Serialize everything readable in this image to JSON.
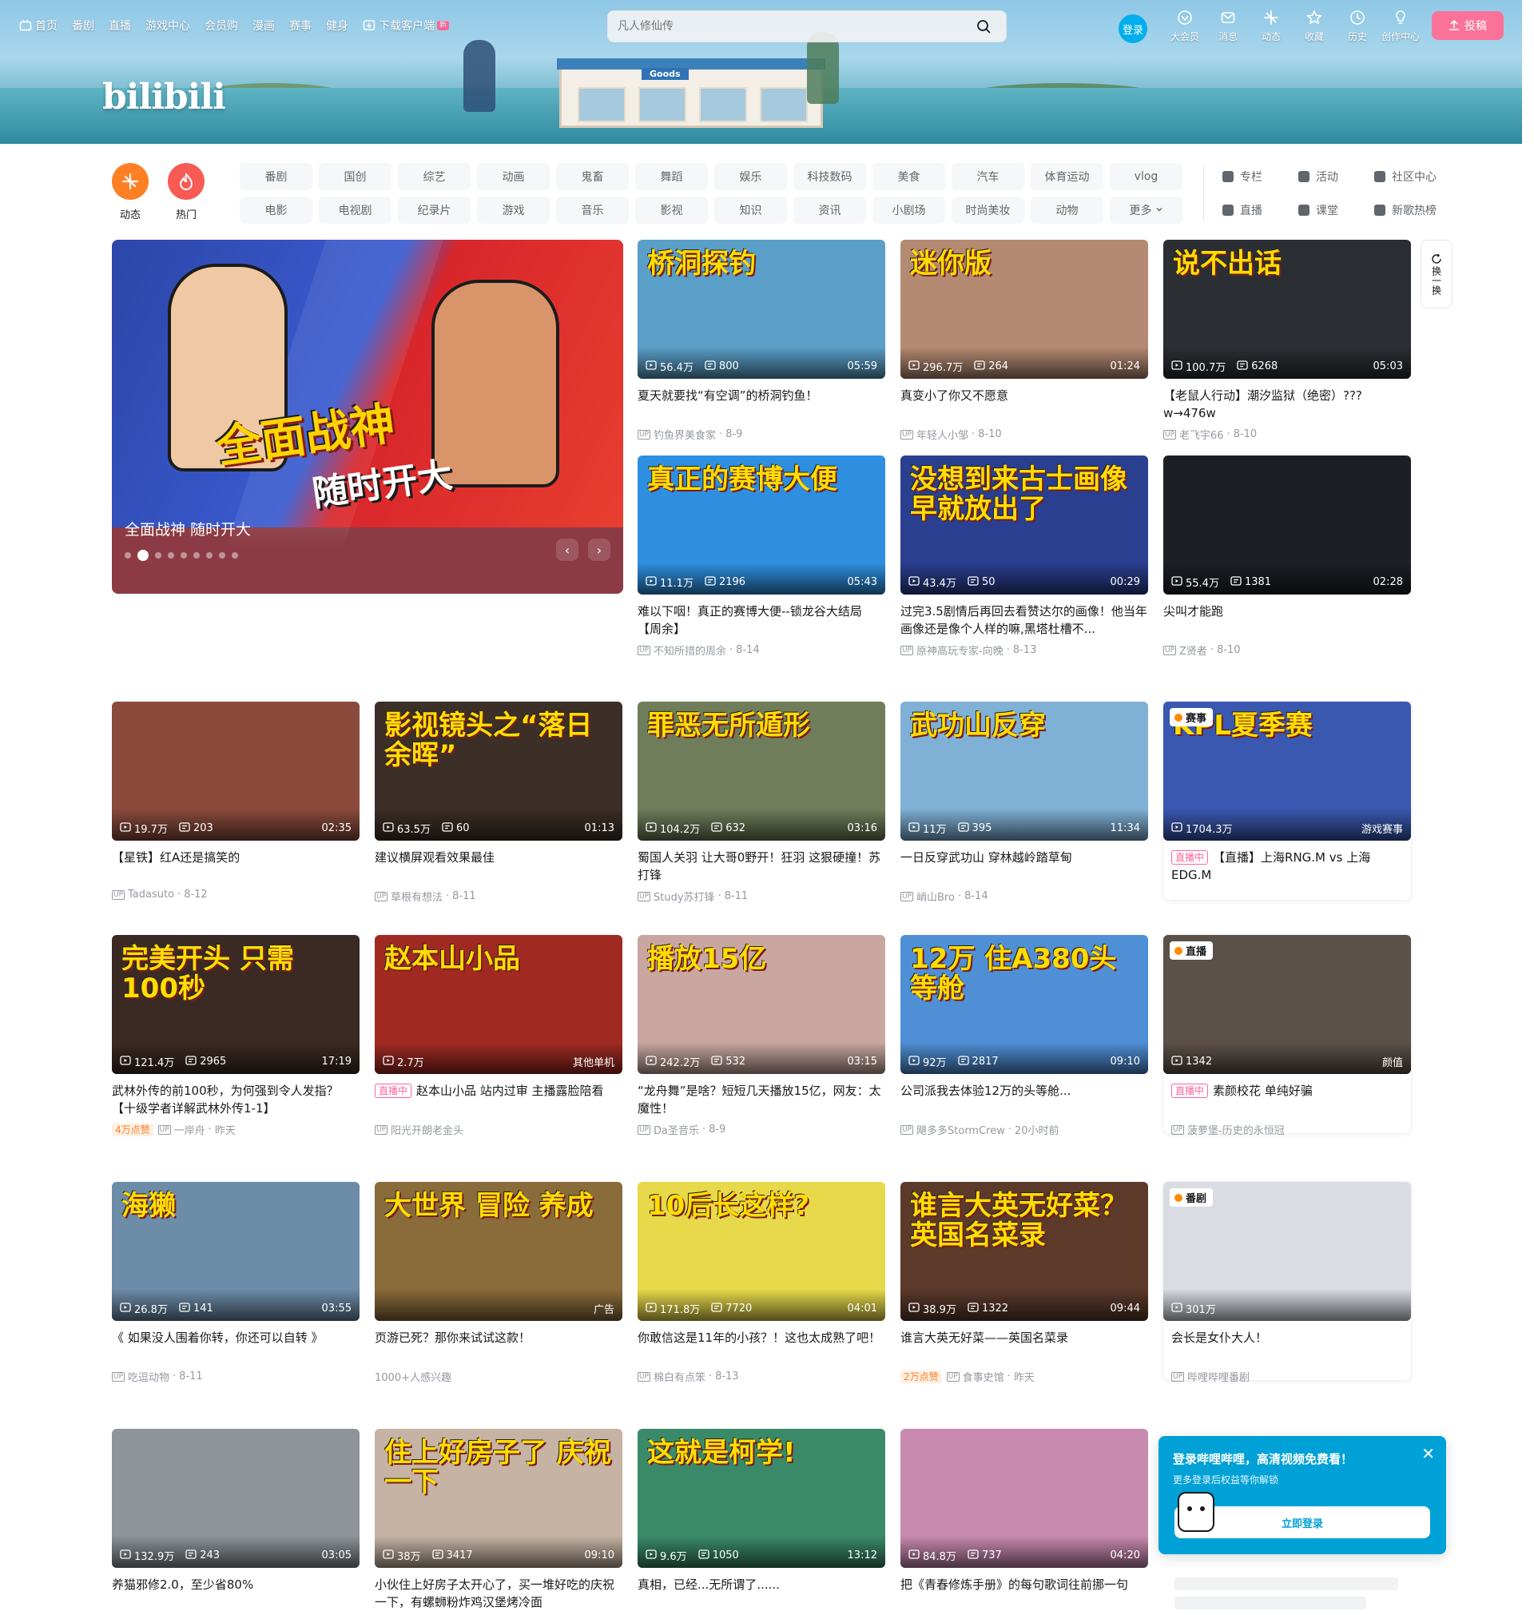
{
  "header": {
    "nav": [
      {
        "label": "首页",
        "icon": "tv-icon"
      },
      {
        "label": "番剧"
      },
      {
        "label": "直播"
      },
      {
        "label": "游戏中心"
      },
      {
        "label": "会员购"
      },
      {
        "label": "漫画"
      },
      {
        "label": "赛事"
      },
      {
        "label": "健身"
      },
      {
        "label": "下载客户端",
        "icon": "download-icon",
        "badge": "新"
      }
    ],
    "search_placeholder": "凡人修仙传",
    "login_label": "登录",
    "right_nav": [
      {
        "label": "大会员",
        "icon": "vip-icon"
      },
      {
        "label": "消息",
        "icon": "message-icon"
      },
      {
        "label": "动态",
        "icon": "dynamic-icon"
      },
      {
        "label": "收藏",
        "icon": "favorite-icon"
      },
      {
        "label": "历史",
        "icon": "history-icon"
      },
      {
        "label": "创作中心",
        "icon": "creator-icon"
      }
    ],
    "upload_label": "投稿",
    "logo_text": "bilibili"
  },
  "channels": {
    "big": [
      {
        "label": "动态",
        "color": "#ff7f24",
        "icon": "dynamic-icon"
      },
      {
        "label": "热门",
        "color": "#f85a54",
        "icon": "fire-icon"
      }
    ],
    "grid": [
      "番剧",
      "国创",
      "综艺",
      "动画",
      "鬼畜",
      "舞蹈",
      "娱乐",
      "科技数码",
      "美食",
      "汽车",
      "体育运动",
      "vlog",
      "电影",
      "电视剧",
      "纪录片",
      "游戏",
      "音乐",
      "影视",
      "知识",
      "资讯",
      "小剧场",
      "时尚美妆",
      "动物",
      "更多"
    ],
    "extra": [
      "专栏",
      "活动",
      "社区中心",
      "直播",
      "课堂",
      "新歌热榜"
    ]
  },
  "carousel": {
    "title": "全面战神 随时开大",
    "art_caption": "全面战神",
    "art_caption2": "随时开大"
  },
  "refresh_label": "换一换",
  "feed_top": [
    {
      "title": "夏天就要找“有空调”的桥洞钓鱼！",
      "views": "56.4万",
      "danmaku": "800",
      "duration": "05:59",
      "author": "钓鱼界美食家",
      "date": "8-9",
      "bg": "#5a9fc8",
      "overlay": "桥洞探钓"
    },
    {
      "title": "真变小了你又不愿意",
      "views": "296.7万",
      "danmaku": "264",
      "duration": "01:24",
      "author": "年轻人小邹",
      "date": "8-10",
      "bg": "#b58a72",
      "overlay": "迷你版"
    },
    {
      "title": "【老鼠人行动】潮汐监狱（绝密）???w→476w",
      "views": "100.7万",
      "danmaku": "6268",
      "duration": "05:03",
      "author": "老飞宇66",
      "date": "8-10",
      "bg": "#2b2e33",
      "overlay": "说不出话"
    },
    {
      "title": "难以下咽！真正的赛博大便--锁龙谷大结局【周余】",
      "views": "11.1万",
      "danmaku": "2196",
      "duration": "05:43",
      "author": "不知所措的周余",
      "date": "8-14",
      "bg": "#2e8fe0",
      "overlay": "真正的赛博大便"
    },
    {
      "title": "过完3.5剧情后再回去看赞达尔的画像！他当年画像还是像个人样的嘛,黑塔杜槽不...",
      "views": "43.4万",
      "danmaku": "50",
      "duration": "00:29",
      "author": "原神高玩专家-向晚",
      "date": "8-13",
      "bg": "#2a3f8f",
      "overlay": "没想到来古士画像早就放出了"
    },
    {
      "title": "尖叫才能跑",
      "views": "55.4万",
      "danmaku": "1381",
      "duration": "02:28",
      "author": "Z贤者",
      "date": "8-10",
      "bg": "#1c1f24",
      "overlay": ""
    }
  ],
  "feed": [
    {
      "title": "【星铁】红A还是搞笑的",
      "views": "19.7万",
      "danmaku": "203",
      "duration": "02:35",
      "author": "Tadasuto",
      "date": "8-12",
      "bg": "#8a4b3c",
      "overlay": ""
    },
    {
      "title": "建议横屏观看效果最佳",
      "views": "63.5万",
      "danmaku": "60",
      "duration": "01:13",
      "author": "草根有想法",
      "date": "8-11",
      "bg": "#3b2f27",
      "overlay": "影视镜头之“落日余晖”"
    },
    {
      "title": "蜀国人关羽 让大哥0野开！狂羽 这狠硬撞！苏打锋",
      "views": "104.2万",
      "danmaku": "632",
      "duration": "03:16",
      "author": "Study苏打锋",
      "date": "8-11",
      "bg": "#6f7d5a",
      "overlay": "罪恶无所遁形"
    },
    {
      "title": "一日反穿武功山 穿林越岭踏草甸",
      "views": "11万",
      "danmaku": "395",
      "duration": "11:34",
      "author": "峭山Bro",
      "date": "8-14",
      "bg": "#7fb0d6",
      "overlay": "武功山反穿"
    },
    {
      "title": "【直播】上海RNG.M vs 上海EDG.M",
      "views": "1704.3万",
      "danmaku": "",
      "duration": "游戏赛事",
      "author": "",
      "date": "",
      "bg": "#3a58b0",
      "overlay": "KPL夏季赛",
      "tag": "赛事",
      "live": "直播中",
      "boxed": true
    },
    {
      "title": "武林外传的前100秒，为何强到令人发指？【十级学者详解武林外传1-1】",
      "views": "121.4万",
      "danmaku": "2965",
      "duration": "17:19",
      "author": "一岸舟",
      "date": "昨天",
      "bg": "#3b2a24",
      "overlay": "完美开头 只需100秒",
      "likes": "4万点赞"
    },
    {
      "title": "赵本山小品 站内过审 主播露脸陪看",
      "views": "2.7万",
      "danmaku": "",
      "duration": "其他单机",
      "author": "阳光开朗老金头",
      "date": "",
      "bg": "#a02a22",
      "overlay": "赵本山小品",
      "live": "直播中"
    },
    {
      "title": "“龙舟舞”是啥？短短几天播放15亿，网友：太魔性！",
      "views": "242.2万",
      "danmaku": "532",
      "duration": "03:15",
      "author": "Da圣音乐",
      "date": "8-9",
      "bg": "#c9a7a0",
      "overlay": "播放15亿"
    },
    {
      "title": "公司派我去体验12万的头等舱...",
      "views": "92万",
      "danmaku": "2817",
      "duration": "09:10",
      "author": "飓多多StormCrew",
      "date": "20小时前",
      "bg": "#4f8fd6",
      "overlay": "12万 住A380头等舱"
    },
    {
      "title": "素颜校花 单纯好骗",
      "views": "1342",
      "danmaku": "",
      "duration": "颜值",
      "author": "菠萝堡-历史的永恒冠",
      "date": "",
      "bg": "#5c5149",
      "overlay": "",
      "tag": "直播",
      "live": "直播中",
      "boxed": true
    },
    {
      "title": "《 如果没人围着你转，你还可以自转 》",
      "views": "26.8万",
      "danmaku": "141",
      "duration": "03:55",
      "author": "吃逗动物",
      "date": "8-11",
      "bg": "#6d8ca8",
      "overlay": "海獭"
    },
    {
      "title": "页游已死？那你来试试这款！",
      "views": "",
      "danmaku": "",
      "duration": "广告",
      "author": "1000+人感兴趣",
      "date": "",
      "bg": "#8a6b3a",
      "overlay": "大世界 冒险 养成"
    },
    {
      "title": "你敢信这是11年的小孩？！这也太成熟了吧！",
      "views": "171.8万",
      "danmaku": "7720",
      "duration": "04:01",
      "author": "棉白有点笨",
      "date": "8-13",
      "bg": "#e8d94a",
      "overlay": "10后长这样?"
    },
    {
      "title": "谁言大英无好菜——英国名菜录",
      "views": "38.9万",
      "danmaku": "1322",
      "duration": "09:44",
      "author": "食事史馆",
      "date": "昨天",
      "bg": "#5b3a2a",
      "overlay": "谁言大英无好菜？英国名菜录",
      "likes": "2万点赞"
    },
    {
      "title": "会长是女仆大人！",
      "views": "301万",
      "danmaku": "",
      "duration": "",
      "author": "哔哩哔哩番剧",
      "date": "",
      "bg": "#d9dde3",
      "overlay": "",
      "tag": "番剧",
      "boxed": true
    },
    {
      "title": "养猫邪修2.0，至少省80%",
      "views": "132.9万",
      "danmaku": "243",
      "duration": "03:05",
      "author": "",
      "date": "",
      "bg": "#8e9499",
      "overlay": ""
    },
    {
      "title": "小伙住上好房子太开心了，买一堆好吃的庆祝一下，有螺蛳粉炸鸡汉堡烤冷面",
      "views": "38万",
      "danmaku": "3417",
      "duration": "09:10",
      "author": "",
      "date": "",
      "bg": "#c7b3a3",
      "overlay": "住上好房子了 庆祝一下"
    },
    {
      "title": "真相，已经...无所谓了......",
      "views": "9.6万",
      "danmaku": "1050",
      "duration": "13:12",
      "author": "",
      "date": "",
      "bg": "#3a8a6a",
      "overlay": "这就是柯学!"
    },
    {
      "title": "把《青春修炼手册》的每句歌词往前挪一句",
      "views": "84.8万",
      "danmaku": "737",
      "duration": "04:20",
      "author": "",
      "date": "",
      "bg": "#c98ab0",
      "overlay": ""
    }
  ],
  "popup": {
    "title": "登录哔哩哔哩，高清视频免费看！",
    "subtitle": "更多登录后权益等你解锁",
    "button": "立即登录"
  }
}
